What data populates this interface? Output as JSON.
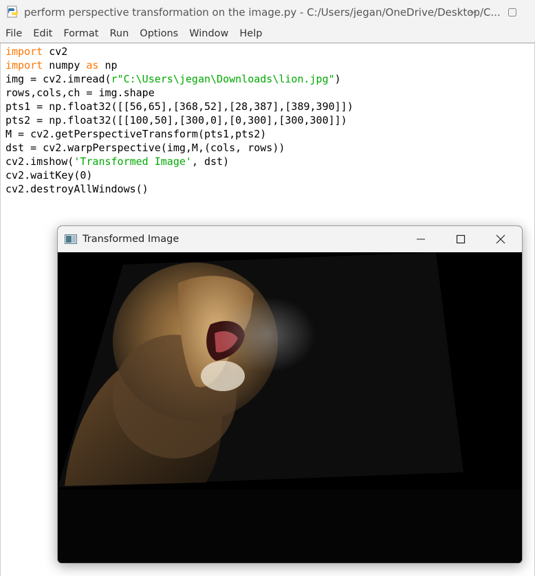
{
  "window": {
    "title": "perform perspective transformation on the image.py - C:/Users/jegan/OneDrive/Desktop/C..."
  },
  "menubar": {
    "items": [
      "File",
      "Edit",
      "Format",
      "Run",
      "Options",
      "Window",
      "Help"
    ]
  },
  "code": {
    "lines": [
      [
        {
          "k": "kw",
          "t": "import"
        },
        {
          "k": "",
          "t": " cv2"
        }
      ],
      [
        {
          "k": "kw",
          "t": "import"
        },
        {
          "k": "",
          "t": " numpy "
        },
        {
          "k": "kw",
          "t": "as"
        },
        {
          "k": "",
          "t": " np"
        }
      ],
      [
        {
          "k": "",
          "t": "img = cv2.imread("
        },
        {
          "k": "str",
          "t": "r\"C:\\Users\\jegan\\Downloads\\lion.jpg\""
        },
        {
          "k": "",
          "t": ")"
        }
      ],
      [
        {
          "k": "",
          "t": "rows,cols,ch = img.shape"
        }
      ],
      [
        {
          "k": "",
          "t": "pts1 = np.float32([[56,65],[368,52],[28,387],[389,390]])"
        }
      ],
      [
        {
          "k": "",
          "t": "pts2 = np.float32([[100,50],[300,0],[0,300],[300,300]])"
        }
      ],
      [
        {
          "k": "",
          "t": "M = cv2.getPerspectiveTransform(pts1,pts2)"
        }
      ],
      [
        {
          "k": "",
          "t": "dst = cv2.warpPerspective(img,M,(cols, rows))"
        }
      ],
      [
        {
          "k": "",
          "t": "cv2.imshow("
        },
        {
          "k": "str",
          "t": "'Transformed Image'"
        },
        {
          "k": "",
          "t": ", dst)"
        }
      ],
      [
        {
          "k": "",
          "t": "cv2.waitKey(0)"
        }
      ],
      [
        {
          "k": "",
          "t": "cv2.destroyAllWindows()"
        }
      ]
    ]
  },
  "cv_window": {
    "title": "Transformed Image"
  },
  "icons": {
    "python_file": "python-file-icon",
    "minimize": "minimize-icon",
    "maximize": "maximize-icon",
    "close": "close-icon",
    "image_app": "image-app-icon"
  }
}
